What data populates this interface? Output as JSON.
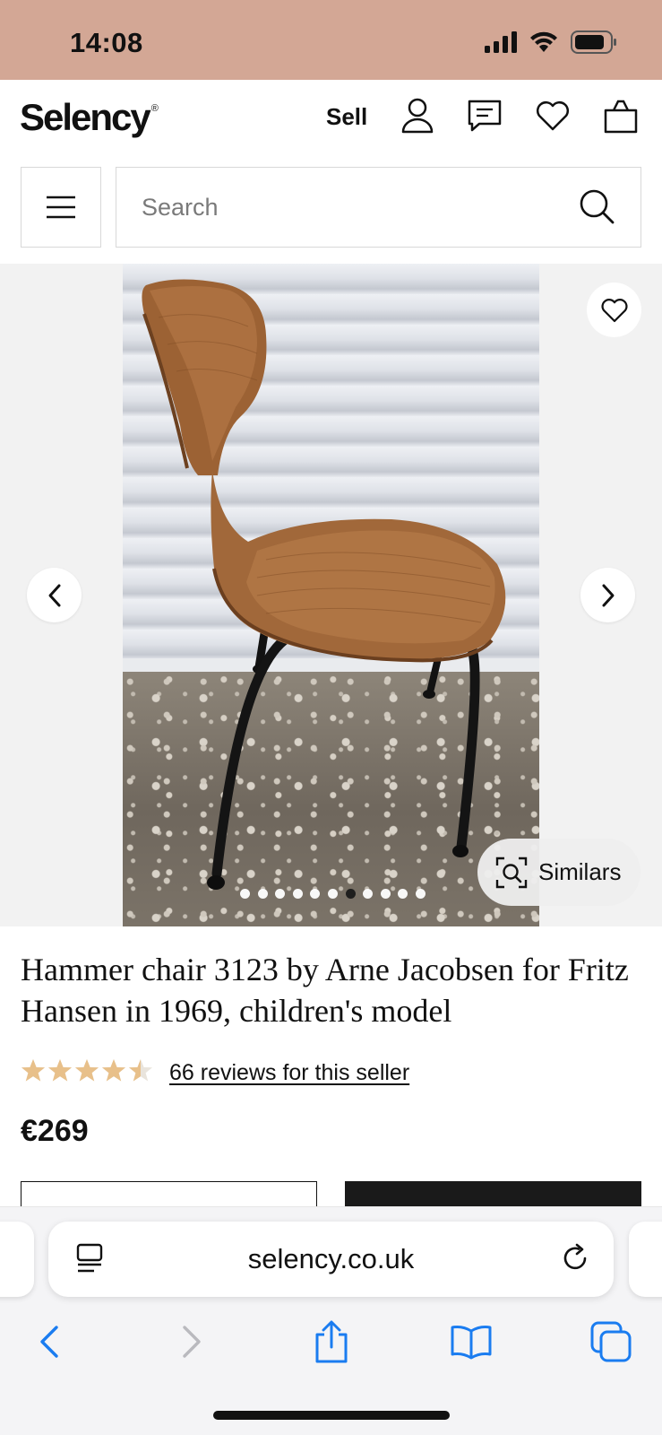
{
  "status_bar": {
    "time": "14:08",
    "bg_color": "#d3a795"
  },
  "header": {
    "logo": "Selency",
    "logo_mark": "®",
    "sell_label": "Sell",
    "icons": [
      "account-icon",
      "messages-icon",
      "favorites-icon",
      "bag-icon"
    ]
  },
  "search": {
    "placeholder": "Search"
  },
  "gallery": {
    "image_count": 11,
    "active_index": 6,
    "similars_label": "Similars"
  },
  "product": {
    "title": "Hammer chair 3123 by Arne Jacobsen for Fritz Hansen in 1969, children's model",
    "rating": 4.5,
    "rating_max": 5,
    "star_color": "#e8c08a",
    "reviews_link": "66 reviews for this seller",
    "price": "€269"
  },
  "browser": {
    "url": "selency.co.uk",
    "accent_color": "#1a7cf0",
    "toolbar": [
      "back-icon",
      "forward-icon",
      "share-icon",
      "bookmarks-icon",
      "tabs-icon"
    ]
  }
}
